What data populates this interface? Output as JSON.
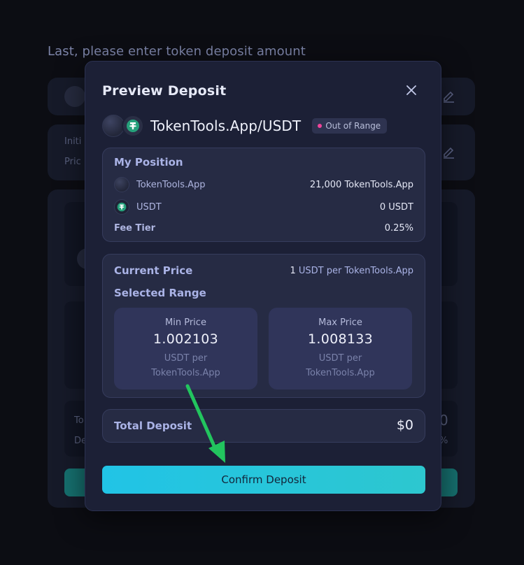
{
  "background": {
    "title": "Last, please enter token deposit amount",
    "partial_labels": [
      "Initi",
      "Pric",
      "To",
      "De"
    ],
    "partial_values": [
      "0",
      "%"
    ]
  },
  "modal": {
    "title": "Preview Deposit",
    "close_icon": "close-icon",
    "pair": {
      "name": "TokenTools.App/USDT",
      "status": "Out of Range",
      "status_color": "#f0449a"
    },
    "position": {
      "heading": "My Position",
      "rows": [
        {
          "token": "TokenTools.App",
          "amount": "21,000 TokenTools.App"
        },
        {
          "token": "USDT",
          "amount": "0 USDT"
        }
      ],
      "fee_label": "Fee Tier",
      "fee_value": "0.25%"
    },
    "price": {
      "current_label": "Current Price",
      "current_number": "1",
      "current_unit": "USDT per TokenTools.App",
      "range_label": "Selected Range",
      "min": {
        "label": "Min Price",
        "value": "1.002103",
        "unit_line1": "USDT per",
        "unit_line2": "TokenTools.App"
      },
      "max": {
        "label": "Max Price",
        "value": "1.008133",
        "unit_line1": "USDT per",
        "unit_line2": "TokenTools.App"
      }
    },
    "total": {
      "label": "Total Deposit",
      "value": "$0"
    },
    "confirm_label": "Confirm Deposit"
  },
  "colors": {
    "accent": "#21c4e6",
    "arrow": "#22c55e",
    "usdt": "#26a17b"
  }
}
